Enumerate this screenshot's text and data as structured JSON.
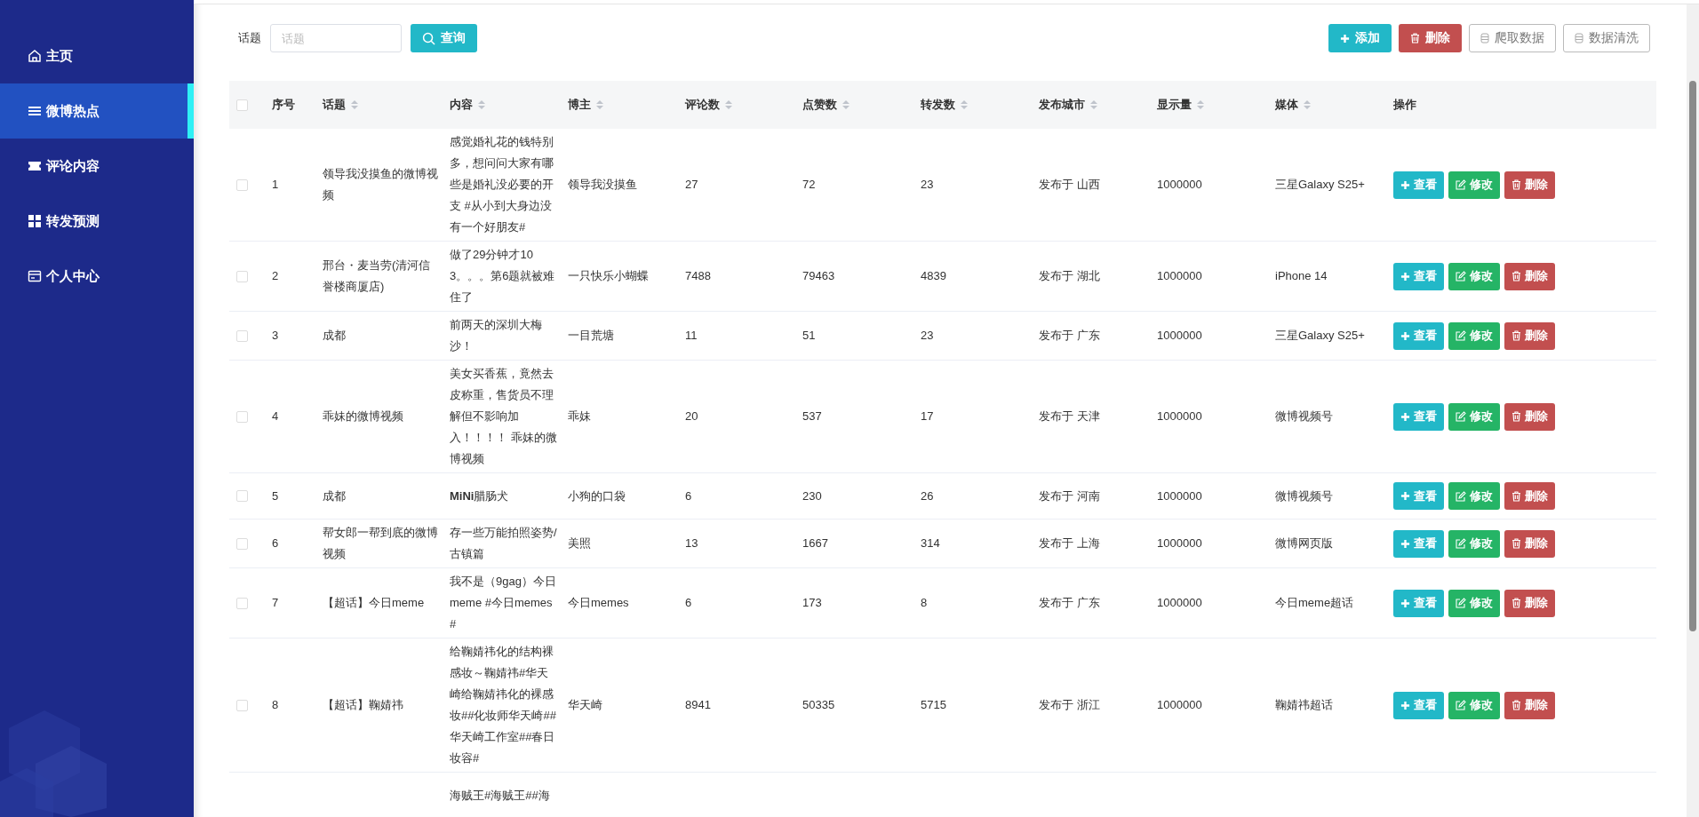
{
  "sidebar": {
    "items": [
      {
        "label": "主页",
        "kind": "home",
        "selected": false
      },
      {
        "label": "微博热点",
        "kind": "list",
        "selected": true
      },
      {
        "label": "评论内容",
        "kind": "ticket",
        "selected": false
      },
      {
        "label": "转发预测",
        "kind": "grid",
        "selected": false
      },
      {
        "label": "个人中心",
        "kind": "card",
        "selected": false
      }
    ]
  },
  "search": {
    "label": "话题",
    "placeholder": "话题",
    "button": "查询"
  },
  "toolbar": [
    {
      "kind": "add",
      "label": "添加"
    },
    {
      "kind": "delete",
      "label": "删除"
    },
    {
      "kind": "plain",
      "label": "爬取数据"
    },
    {
      "kind": "plain",
      "label": "数据清洗"
    }
  ],
  "table": {
    "select_all_checked": false,
    "columns": [
      {
        "label": "序号",
        "sortable": false
      },
      {
        "label": "话题",
        "sortable": true
      },
      {
        "label": "内容",
        "sortable": true
      },
      {
        "label": "博主",
        "sortable": true
      },
      {
        "label": "评论数",
        "sortable": true
      },
      {
        "label": "点赞数",
        "sortable": true
      },
      {
        "label": "转发数",
        "sortable": true
      },
      {
        "label": "发布城市",
        "sortable": true
      },
      {
        "label": "显示量",
        "sortable": true
      },
      {
        "label": "媒体",
        "sortable": true
      },
      {
        "label": "操作",
        "sortable": false
      }
    ],
    "rows": [
      {
        "checked": false,
        "cells": [
          "1",
          "领导我没摸鱼的微博视频",
          "感觉婚礼花的钱特别多，想问问大家有哪些是婚礼没必要的开支 #从小到大身边没有一个好朋友#",
          "领导我没摸鱼",
          "27",
          "72",
          "23",
          "发布于 山西",
          "1000000",
          "三星Galaxy S25+"
        ],
        "actions": [
          {
            "kind": "view",
            "label": "查看"
          },
          {
            "kind": "edit",
            "label": "修改"
          },
          {
            "kind": "delete",
            "label": "删除"
          }
        ]
      },
      {
        "checked": false,
        "cells": [
          "2",
          "邢台・麦当劳(清河信誉楼商厦店)",
          "做了29分钟才103。。。第6题就被难住了",
          "一只快乐小蝴蝶",
          "7488",
          "79463",
          "4839",
          "发布于 湖北",
          "1000000",
          "iPhone 14"
        ],
        "actions": [
          {
            "kind": "view",
            "label": "查看"
          },
          {
            "kind": "edit",
            "label": "修改"
          },
          {
            "kind": "delete",
            "label": "删除"
          }
        ]
      },
      {
        "checked": false,
        "cells": [
          "3",
          "成都",
          "前两天的深圳大梅沙！",
          "一目荒塘",
          "11",
          "51",
          "23",
          "发布于 广东",
          "1000000",
          "三星Galaxy S25+"
        ],
        "actions": [
          {
            "kind": "view",
            "label": "查看"
          },
          {
            "kind": "edit",
            "label": "修改"
          },
          {
            "kind": "delete",
            "label": "删除"
          }
        ]
      },
      {
        "checked": false,
        "cells": [
          "4",
          "乖妹的微博视频",
          "美女买香蕉，竟然去皮称重，售货员不理解但不影响加入！！！！ 乖妹的微博视频",
          "乖妹",
          "20",
          "537",
          "17",
          "发布于 天津",
          "1000000",
          "微博视频号"
        ],
        "actions": [
          {
            "kind": "view",
            "label": "查看"
          },
          {
            "kind": "edit",
            "label": "修改"
          },
          {
            "kind": "delete",
            "label": "删除"
          }
        ]
      },
      {
        "checked": false,
        "cells": [
          "5",
          "成都",
          "**MiNi**腊肠犬",
          "小狗的口袋",
          "6",
          "230",
          "26",
          "发布于 河南",
          "1000000",
          "微博视频号"
        ],
        "actions": [
          {
            "kind": "view",
            "label": "查看"
          },
          {
            "kind": "edit",
            "label": "修改"
          },
          {
            "kind": "delete",
            "label": "删除"
          }
        ]
      },
      {
        "checked": false,
        "cells": [
          "6",
          "帮女郎一帮到底的微博视频",
          "存一些万能拍照姿势/古镇篇",
          "美照",
          "13",
          "1667",
          "314",
          "发布于 上海",
          "1000000",
          "微博网页版"
        ],
        "actions": [
          {
            "kind": "view",
            "label": "查看"
          },
          {
            "kind": "edit",
            "label": "修改"
          },
          {
            "kind": "delete",
            "label": "删除"
          }
        ]
      },
      {
        "checked": false,
        "cells": [
          "7",
          "【超话】今日meme",
          "我不是（9gag）今日meme #今日memes#",
          "今日memes",
          "6",
          "173",
          "8",
          "发布于 广东",
          "1000000",
          "今日meme超话"
        ],
        "actions": [
          {
            "kind": "view",
            "label": "查看"
          },
          {
            "kind": "edit",
            "label": "修改"
          },
          {
            "kind": "delete",
            "label": "删除"
          }
        ]
      },
      {
        "checked": false,
        "cells": [
          "8",
          "【超话】鞠婧祎",
          "给鞠婧祎化的结构裸感妆～鞠婧祎#华天崎给鞠婧祎化的裸感妆##化妆师华天崎##华天崎工作室##春日妆容#",
          "华天崎",
          "8941",
          "50335",
          "5715",
          "发布于 浙江",
          "1000000",
          "鞠婧祎超话"
        ],
        "actions": [
          {
            "kind": "view",
            "label": "查看"
          },
          {
            "kind": "edit",
            "label": "修改"
          },
          {
            "kind": "delete",
            "label": "删除"
          }
        ]
      },
      {
        "content": "海贼王#海贼王##海"
      }
    ]
  }
}
